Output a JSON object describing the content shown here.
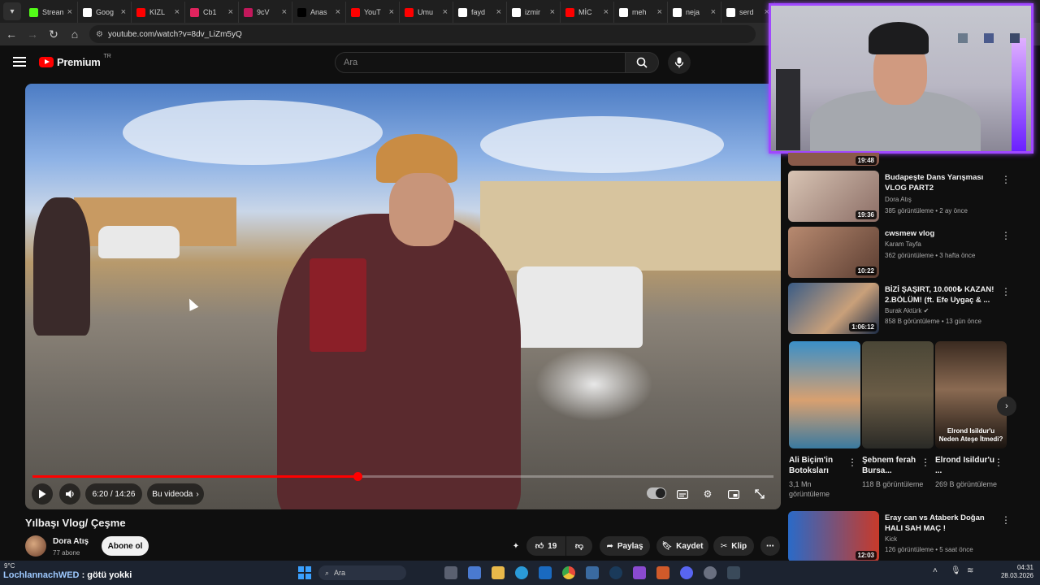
{
  "browser": {
    "tabs": [
      {
        "label": "Stream",
        "color": "#53fc18"
      },
      {
        "label": "Goog",
        "color": "#ffffff"
      },
      {
        "label": "KIZL",
        "color": "#ff0000"
      },
      {
        "label": "Cb1",
        "color": "#e0245e"
      },
      {
        "label": "9cV",
        "color": "#c2185b"
      },
      {
        "label": "Anas",
        "color": "#000000"
      },
      {
        "label": "YouT",
        "color": "#ff0000"
      },
      {
        "label": "Umu",
        "color": "#ff0000"
      },
      {
        "label": "fayd",
        "color": "#ffffff"
      },
      {
        "label": "izmir",
        "color": "#ffffff"
      },
      {
        "label": "MİC",
        "color": "#ff0000"
      },
      {
        "label": "meh",
        "color": "#ffffff"
      },
      {
        "label": "neja",
        "color": "#ffffff"
      },
      {
        "label": "serd",
        "color": "#ffffff"
      }
    ],
    "url": "youtube.com/watch?v=8dv_LiZm5yQ"
  },
  "header": {
    "brand": "Premium",
    "region": "TR",
    "search_placeholder": "Ara"
  },
  "player": {
    "time": "6:20 / 14:26",
    "chapter_label": "Bu videoda",
    "progress_fraction": 0.439
  },
  "video": {
    "title": "Yılbaşı Vlog/ Çeşme",
    "channel": "Dora Atış",
    "subscribers": "77 abone",
    "subscribe_label": "Abone ol",
    "likes": "19",
    "share_label": "Paylaş",
    "save_label": "Kaydet",
    "clip_label": "Klip"
  },
  "sidebar": {
    "partial_duration": "19:48",
    "videos": [
      {
        "title": "Budapeşte Dans Yarışması VLOG PART2",
        "channel": "Dora Atış",
        "meta": "385 görüntüleme • 2 ay önce",
        "duration": "19:36"
      },
      {
        "title": "cwsmew vlog",
        "channel": "Karam Tayfa",
        "meta": "362 görüntüleme • 3 hafta önce",
        "duration": "10:22"
      },
      {
        "title": "BİZİ ŞAŞIRT, 10.000₺ KAZAN! 2.BÖLÜM! (ft. Efe Uygaç & ...",
        "channel": "Burak Aktürk",
        "meta": "858 B görüntüleme • 13 gün önce",
        "duration": "1:06:12"
      }
    ],
    "shorts": [
      {
        "title": "Ali Biçim'in Botoksları",
        "views": "3,1 Mn görüntüleme"
      },
      {
        "title": "Şebnem ferah Bursa...",
        "views": "118 B görüntüleme"
      },
      {
        "title": "Elrond Isildur'u ...",
        "views": "269 B görüntüleme",
        "overlay": "Elrond Isildur'u Neden Ateşe İtmedi?"
      }
    ],
    "bottom_video": {
      "title": "Eray can vs Ataberk Doğan HALI SAH MAÇ !",
      "channel": "Kick",
      "meta": "126 görüntüleme • 5 saat önce",
      "duration": "12:03"
    }
  },
  "taskbar": {
    "weather": "9°C",
    "search_label": "Ara",
    "time": "04:31",
    "date": "28.03.2026"
  },
  "stream_overlay": {
    "username": "LochlannachWED",
    "message": " : götü yokki"
  }
}
